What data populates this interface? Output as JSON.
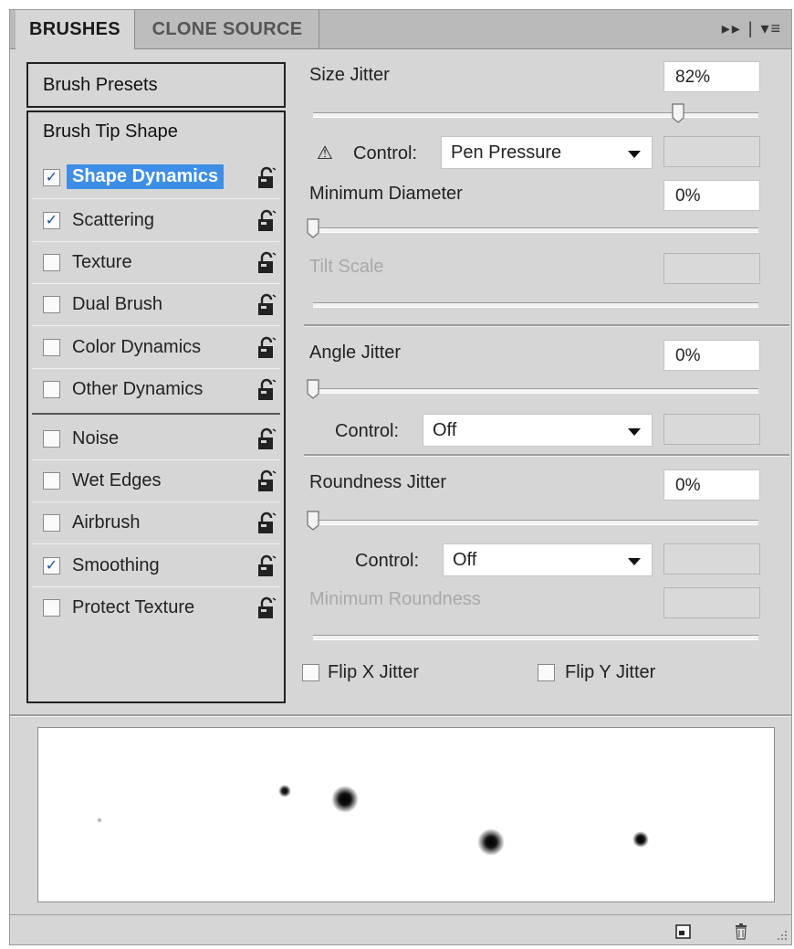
{
  "tabs": {
    "brushes": "BRUSHES",
    "clone_source": "CLONE SOURCE",
    "menu": "▸▸ | ▾≡"
  },
  "left": {
    "presets": "Brush Presets",
    "tip_shape": "Brush Tip Shape",
    "options": [
      {
        "label": "Shape Dynamics",
        "checked": true,
        "selected": true
      },
      {
        "label": "Scattering",
        "checked": true
      },
      {
        "label": "Texture",
        "checked": false
      },
      {
        "label": "Dual Brush",
        "checked": false
      },
      {
        "label": "Color Dynamics",
        "checked": false
      },
      {
        "label": "Other Dynamics",
        "checked": false
      },
      {
        "label": "Noise",
        "checked": false
      },
      {
        "label": "Wet Edges",
        "checked": false
      },
      {
        "label": "Airbrush",
        "checked": false
      },
      {
        "label": "Smoothing",
        "checked": true
      },
      {
        "label": "Protect Texture",
        "checked": false
      }
    ],
    "check_mark": "✓"
  },
  "settings": {
    "size_jitter": {
      "label": "Size Jitter",
      "value": "82%",
      "level": 0.82
    },
    "control1": {
      "warn": "⚠",
      "label": "Control:",
      "value": "Pen Pressure"
    },
    "min_diameter": {
      "label": "Minimum Diameter",
      "value": "0%",
      "level": 0
    },
    "tilt_scale": {
      "label": "Tilt Scale"
    },
    "angle_jitter": {
      "label": "Angle Jitter",
      "value": "0%",
      "level": 0
    },
    "control2": {
      "label": "Control:",
      "value": "Off"
    },
    "roundness_jitter": {
      "label": "Roundness Jitter",
      "value": "0%",
      "level": 0
    },
    "control3": {
      "label": "Control:",
      "value": "Off"
    },
    "min_roundness": {
      "label": "Minimum Roundness"
    },
    "flip_x": {
      "label": "Flip X Jitter",
      "checked": false
    },
    "flip_y": {
      "label": "Flip Y Jitter",
      "checked": false
    }
  },
  "colors": {
    "panel": "#d6d6d6",
    "selection": "#3d8ee6",
    "check": "#1d4fa8"
  }
}
